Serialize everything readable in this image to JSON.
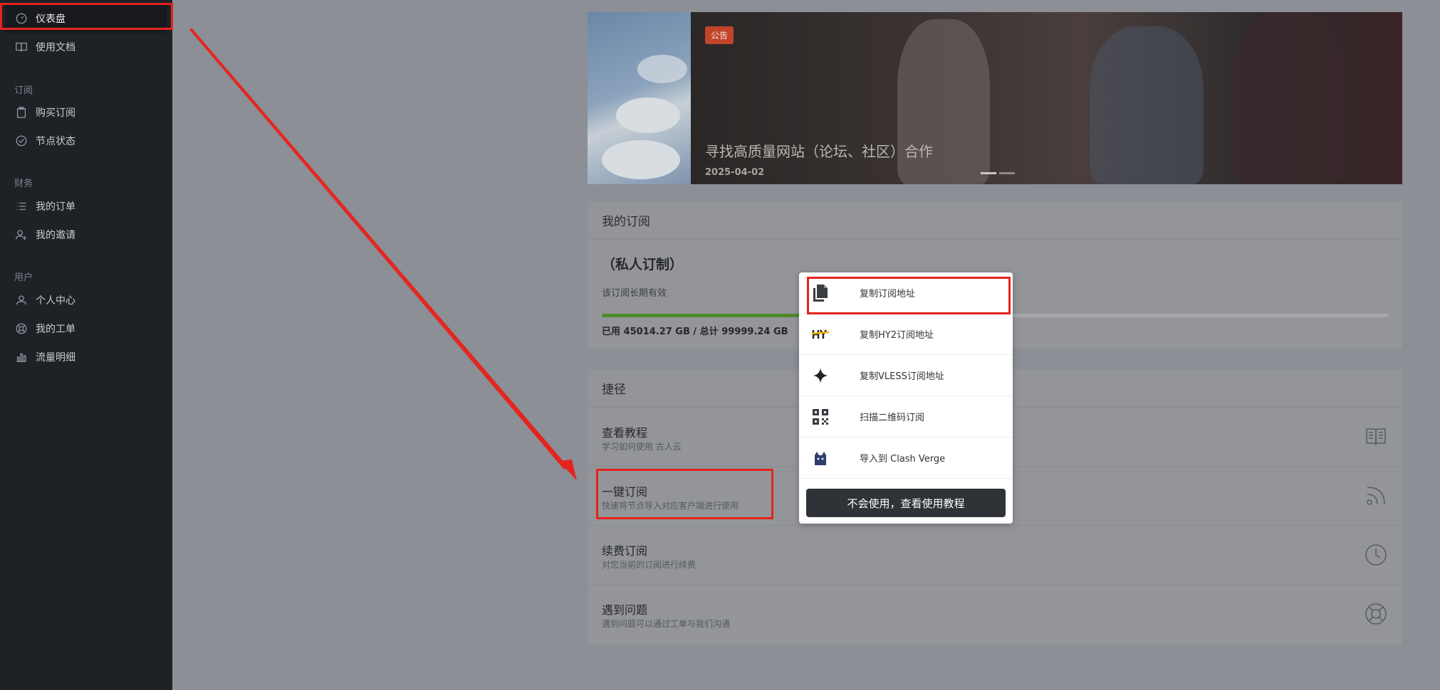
{
  "sidebar": {
    "items": {
      "dashboard": "仪表盘",
      "docs": "使用文档",
      "buy": "购买订阅",
      "nodes": "节点状态",
      "orders": "我的订单",
      "invite": "我的邀请",
      "profile": "个人中心",
      "tickets": "我的工单",
      "traffic": "流量明细"
    },
    "groups": {
      "subscribe": "订阅",
      "finance": "财务",
      "user": "用户"
    }
  },
  "banner": {
    "tag": "公告",
    "title": "寻找高质量网站（论坛、社区）合作",
    "date": "2025-04-02"
  },
  "subscription": {
    "header": "我的订阅",
    "plan_name": "（私人订制）",
    "validity": "该订阅长期有效",
    "usage_text": "已用 45014.27 GB / 总计 99999.24 GB",
    "usage_fraction": 0.45
  },
  "shortcuts": {
    "header": "捷径",
    "rows": [
      {
        "title": "查看教程",
        "subtitle": "学习如何使用 古人云"
      },
      {
        "title": "一键订阅",
        "subtitle": "快速将节点导入对应客户端进行使用"
      },
      {
        "title": "续费订阅",
        "subtitle": "对您当前的订阅进行续费"
      },
      {
        "title": "遇到问题",
        "subtitle": "遇到问题可以通过工单与我们沟通"
      }
    ]
  },
  "popup": {
    "items": [
      {
        "label": "复制订阅地址",
        "icon": "copy-icon"
      },
      {
        "label": "复制HY2订阅地址",
        "icon": "hy2-icon"
      },
      {
        "label": "复制VLESS订阅地址",
        "icon": "vless-star-icon"
      },
      {
        "label": "扫描二维码订阅",
        "icon": "qrcode-icon"
      },
      {
        "label": "导入到 Clash Verge",
        "icon": "clash-cat-icon"
      }
    ],
    "tutorial_button": "不会使用，查看使用教程"
  },
  "colors": {
    "sidebar_bg": "#1e2126",
    "annotation_red": "#e5231e",
    "progress_green": "#4f8a2a",
    "tag_orange": "#c2442a"
  }
}
